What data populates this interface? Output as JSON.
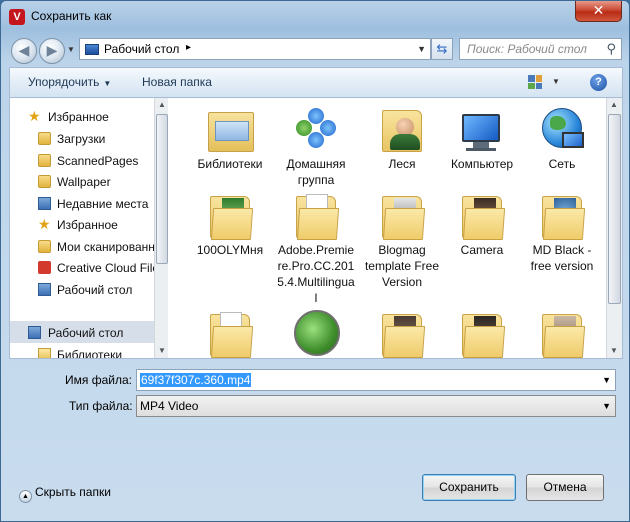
{
  "window": {
    "title": "Сохранить как",
    "app_logo": "V",
    "close_label": "✕"
  },
  "address": {
    "path": "Рабочий стол",
    "separator": "▸"
  },
  "search": {
    "placeholder": "Поиск: Рабочий стол"
  },
  "toolbar": {
    "organize_label": "Упорядочить",
    "new_folder_label": "Новая папка",
    "help_label": "?"
  },
  "sidebar": {
    "items": [
      {
        "label": "Избранное",
        "icon": "star-icon"
      },
      {
        "label": "Загрузки",
        "icon": "folder-icon"
      },
      {
        "label": "ScannedPages",
        "icon": "folder-icon"
      },
      {
        "label": "Wallpaper",
        "icon": "folder-icon"
      },
      {
        "label": "Недавние места",
        "icon": "recent-places-icon"
      },
      {
        "label": "Избранное",
        "icon": "star-icon"
      },
      {
        "label": "Мои сканированны",
        "icon": "folder-icon"
      },
      {
        "label": "Creative Cloud File",
        "icon": "creative-cloud-icon"
      },
      {
        "label": "Рабочий стол",
        "icon": "desktop-icon"
      },
      {
        "label": "Рабочий стол",
        "icon": "desktop-icon"
      },
      {
        "label": "Библиотеки",
        "icon": "libraries-icon"
      }
    ]
  },
  "files": [
    {
      "name": "Библиотеки",
      "icon": "libraries-icon"
    },
    {
      "name": "Домашняя группа",
      "icon": "homegroup-icon"
    },
    {
      "name": "Леся",
      "icon": "user-folder-icon"
    },
    {
      "name": "Компьютер",
      "icon": "computer-icon"
    },
    {
      "name": "Сеть",
      "icon": "network-icon"
    },
    {
      "name": "100OLYMня",
      "icon": "folder-icon"
    },
    {
      "name": "Adobe.Premiere.Pro.CC.2015.4.Multilingual",
      "icon": "folder-icon"
    },
    {
      "name": "Blogmag template Free Version",
      "icon": "folder-icon"
    },
    {
      "name": "Camera",
      "icon": "folder-icon"
    },
    {
      "name": "MD Black - free version",
      "icon": "folder-icon"
    },
    {
      "name": "",
      "icon": "folder-icon"
    },
    {
      "name": "",
      "icon": "torrent-app-icon"
    },
    {
      "name": "",
      "icon": "folder-icon"
    },
    {
      "name": "",
      "icon": "folder-icon"
    },
    {
      "name": "",
      "icon": "folder-icon"
    }
  ],
  "form": {
    "filename_label": "Имя файла:",
    "filename_value": "69f37f307c.360.mp4",
    "filetype_label": "Тип файла:",
    "filetype_value": "MP4 Video"
  },
  "footer": {
    "hide_folders_label": "Скрыть папки",
    "save_label": "Сохранить",
    "cancel_label": "Отмена"
  }
}
